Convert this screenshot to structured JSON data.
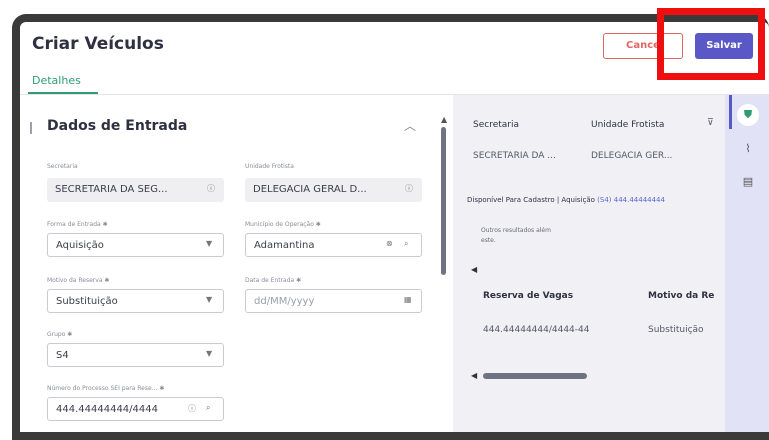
{
  "header": {
    "title": "Criar Veículos",
    "cancel_label": "Cance",
    "save_label": "Salvar"
  },
  "tabs": [
    {
      "label": "Detalhes",
      "active": true
    }
  ],
  "section": {
    "title": "Dados de Entrada",
    "fields": {
      "secretaria": {
        "label": "Secretaria",
        "value": "SECRETARIA DA SEG..."
      },
      "unidade": {
        "label": "Unidade Frotista",
        "value": "DELEGACIA GERAL D..."
      },
      "forma_entrada": {
        "label": "Forma de Entrada ✱",
        "value": "Aquisição"
      },
      "municipio": {
        "label": "Município de Operação ✱",
        "value": "Adamantina"
      },
      "motivo": {
        "label": "Motivo da Reserva ✱",
        "value": "Substituição"
      },
      "data_entrada": {
        "label": "Data de Entrada ✱",
        "placeholder": "dd/MM/yyyy"
      },
      "grupo": {
        "label": "Grupo ✱",
        "value": "S4"
      },
      "processo": {
        "label": "Número do Processo SEI para Rese... ✱",
        "value": "444.44444444/4444"
      }
    }
  },
  "side_panel": {
    "col1_header": "Secretaria",
    "col2_header": "Unidade Frotista",
    "col1_value": "SECRETARIA DA ...",
    "col2_value": "DELEGACIA GER...",
    "availability_label": "Disponível Para Cadastro | Aquisição",
    "availability_link": "(S4)",
    "availability_value": "444.44444444",
    "empty_msg_line1": "Outros resultados além",
    "empty_msg_line2": "este.",
    "table_headers": [
      "Reserva de Vagas",
      "Motivo da Re"
    ],
    "table_row": [
      "444.44444444/4444-44",
      "Substituição"
    ]
  },
  "icons": {
    "rail": [
      "shield-icon",
      "paperclip-icon",
      "document-icon"
    ]
  },
  "colors": {
    "accent": "#5a58c6",
    "tab_active": "#2f9c74",
    "cancel": "#e26565",
    "highlight": "#ee1010"
  }
}
